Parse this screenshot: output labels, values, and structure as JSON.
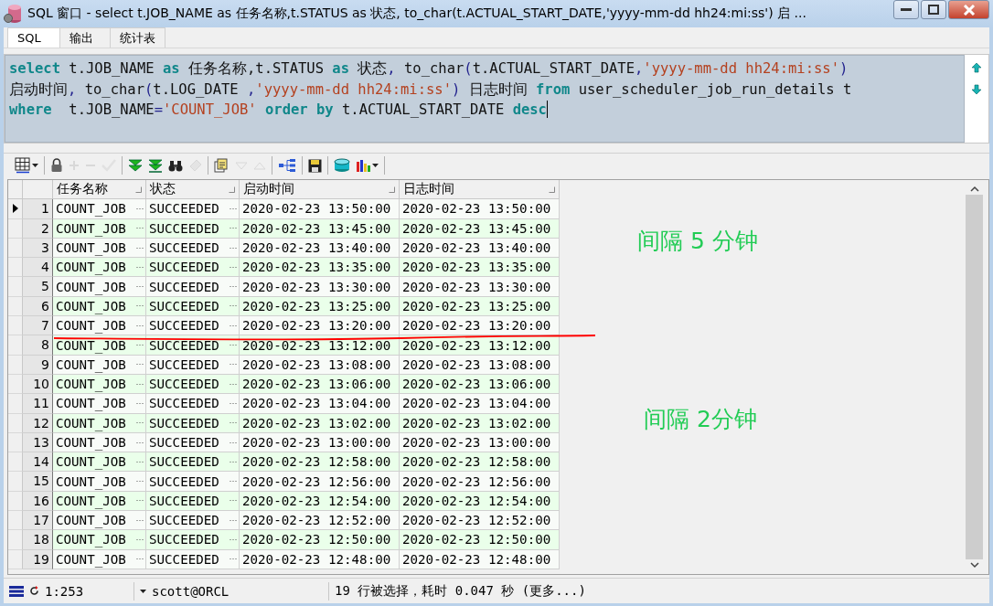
{
  "window": {
    "title": "SQL 窗口 - select t.JOB_NAME as 任务名称,t.STATUS as 状态, to_char(t.ACTUAL_START_DATE,'yyyy-mm-dd hh24:mi:ss') 启 ..."
  },
  "tabs": [
    {
      "label": "SQL",
      "selected": true
    },
    {
      "label": "输出",
      "selected": false
    },
    {
      "label": "统计表",
      "selected": false
    }
  ],
  "editor": {
    "lines": [
      [
        {
          "kind": "keyword",
          "text": "select"
        },
        {
          "kind": "plain",
          "text": " t.JOB_NAME "
        },
        {
          "kind": "keyword",
          "text": "as"
        },
        {
          "kind": "plain",
          "text": " 任务名称,t.STATUS "
        },
        {
          "kind": "keyword",
          "text": "as"
        },
        {
          "kind": "plain",
          "text": " 状态"
        },
        {
          "kind": "punct",
          "text": ","
        },
        {
          "kind": "plain",
          "text": " to_char"
        },
        {
          "kind": "punct",
          "text": "("
        },
        {
          "kind": "plain",
          "text": "t.ACTUAL_START_DATE"
        },
        {
          "kind": "punct",
          "text": ","
        },
        {
          "kind": "string",
          "text": "'yyyy-mm-dd hh24:mi:ss'"
        },
        {
          "kind": "punct",
          "text": ")"
        }
      ],
      [
        {
          "kind": "plain",
          "text": "启动时间"
        },
        {
          "kind": "punct",
          "text": ","
        },
        {
          "kind": "plain",
          "text": " to_char"
        },
        {
          "kind": "punct",
          "text": "("
        },
        {
          "kind": "plain",
          "text": "t.LOG_DATE "
        },
        {
          "kind": "punct",
          "text": ","
        },
        {
          "kind": "string",
          "text": "'yyyy-mm-dd hh24:mi:ss'"
        },
        {
          "kind": "punct",
          "text": ")"
        },
        {
          "kind": "plain",
          "text": " 日志时间 "
        },
        {
          "kind": "keyword",
          "text": "from"
        },
        {
          "kind": "plain",
          "text": " user_scheduler_job_run_details t"
        }
      ],
      [
        {
          "kind": "keyword",
          "text": "where"
        },
        {
          "kind": "plain",
          "text": "  t.JOB_NAME"
        },
        {
          "kind": "punct",
          "text": "="
        },
        {
          "kind": "string",
          "text": "'COUNT_JOB'"
        },
        {
          "kind": "keyword",
          "text": " order by"
        },
        {
          "kind": "plain",
          "text": " t.ACTUAL_START_DATE "
        },
        {
          "kind": "keyword",
          "text": "desc"
        }
      ]
    ]
  },
  "toolbar": [
    [
      {
        "kind": "grid-menu",
        "disabled": false
      }
    ],
    [
      {
        "kind": "lock",
        "disabled": false
      },
      {
        "kind": "add",
        "disabled": true
      },
      {
        "kind": "remove",
        "disabled": true
      },
      {
        "kind": "post",
        "disabled": true
      }
    ],
    [
      {
        "kind": "fetch-next",
        "disabled": false
      },
      {
        "kind": "fetch-all",
        "disabled": false
      },
      {
        "kind": "find",
        "disabled": false
      },
      {
        "kind": "clear",
        "disabled": true
      }
    ],
    [
      {
        "kind": "export",
        "disabled": false
      },
      {
        "kind": "next",
        "disabled": true
      },
      {
        "kind": "previous",
        "disabled": true
      }
    ],
    [
      {
        "kind": "tree",
        "disabled": false
      }
    ],
    [
      {
        "kind": "save",
        "disabled": false
      }
    ],
    [
      {
        "kind": "database",
        "disabled": false
      },
      {
        "kind": "chart",
        "disabled": false
      }
    ]
  ],
  "grid": {
    "columns": [
      "任务名称",
      "状态",
      "启动时间",
      "日志时间"
    ],
    "rows": [
      {
        "number": "1",
        "job_name": "COUNT_JOB",
        "status": "SUCCEEDED",
        "start_time": "2020-02-23 13:50:00",
        "log_time": "2020-02-23 13:50:00",
        "selected": true
      },
      {
        "number": "2",
        "job_name": "COUNT_JOB",
        "status": "SUCCEEDED",
        "start_time": "2020-02-23 13:45:00",
        "log_time": "2020-02-23 13:45:00",
        "selected": false
      },
      {
        "number": "3",
        "job_name": "COUNT_JOB",
        "status": "SUCCEEDED",
        "start_time": "2020-02-23 13:40:00",
        "log_time": "2020-02-23 13:40:00",
        "selected": false
      },
      {
        "number": "4",
        "job_name": "COUNT_JOB",
        "status": "SUCCEEDED",
        "start_time": "2020-02-23 13:35:00",
        "log_time": "2020-02-23 13:35:00",
        "selected": false
      },
      {
        "number": "5",
        "job_name": "COUNT_JOB",
        "status": "SUCCEEDED",
        "start_time": "2020-02-23 13:30:00",
        "log_time": "2020-02-23 13:30:00",
        "selected": false
      },
      {
        "number": "6",
        "job_name": "COUNT_JOB",
        "status": "SUCCEEDED",
        "start_time": "2020-02-23 13:25:00",
        "log_time": "2020-02-23 13:25:00",
        "selected": false
      },
      {
        "number": "7",
        "job_name": "COUNT_JOB",
        "status": "SUCCEEDED",
        "start_time": "2020-02-23 13:20:00",
        "log_time": "2020-02-23 13:20:00",
        "selected": false
      },
      {
        "number": "8",
        "job_name": "COUNT_JOB",
        "status": "SUCCEEDED",
        "start_time": "2020-02-23 13:12:00",
        "log_time": "2020-02-23 13:12:00",
        "selected": false
      },
      {
        "number": "9",
        "job_name": "COUNT_JOB",
        "status": "SUCCEEDED",
        "start_time": "2020-02-23 13:08:00",
        "log_time": "2020-02-23 13:08:00",
        "selected": false
      },
      {
        "number": "10",
        "job_name": "COUNT_JOB",
        "status": "SUCCEEDED",
        "start_time": "2020-02-23 13:06:00",
        "log_time": "2020-02-23 13:06:00",
        "selected": false
      },
      {
        "number": "11",
        "job_name": "COUNT_JOB",
        "status": "SUCCEEDED",
        "start_time": "2020-02-23 13:04:00",
        "log_time": "2020-02-23 13:04:00",
        "selected": false
      },
      {
        "number": "12",
        "job_name": "COUNT_JOB",
        "status": "SUCCEEDED",
        "start_time": "2020-02-23 13:02:00",
        "log_time": "2020-02-23 13:02:00",
        "selected": false
      },
      {
        "number": "13",
        "job_name": "COUNT_JOB",
        "status": "SUCCEEDED",
        "start_time": "2020-02-23 13:00:00",
        "log_time": "2020-02-23 13:00:00",
        "selected": false
      },
      {
        "number": "14",
        "job_name": "COUNT_JOB",
        "status": "SUCCEEDED",
        "start_time": "2020-02-23 12:58:00",
        "log_time": "2020-02-23 12:58:00",
        "selected": false
      },
      {
        "number": "15",
        "job_name": "COUNT_JOB",
        "status": "SUCCEEDED",
        "start_time": "2020-02-23 12:56:00",
        "log_time": "2020-02-23 12:56:00",
        "selected": false
      },
      {
        "number": "16",
        "job_name": "COUNT_JOB",
        "status": "SUCCEEDED",
        "start_time": "2020-02-23 12:54:00",
        "log_time": "2020-02-23 12:54:00",
        "selected": false
      },
      {
        "number": "17",
        "job_name": "COUNT_JOB",
        "status": "SUCCEEDED",
        "start_time": "2020-02-23 12:52:00",
        "log_time": "2020-02-23 12:52:00",
        "selected": false
      },
      {
        "number": "18",
        "job_name": "COUNT_JOB",
        "status": "SUCCEEDED",
        "start_time": "2020-02-23 12:50:00",
        "log_time": "2020-02-23 12:50:00",
        "selected": false
      },
      {
        "number": "19",
        "job_name": "COUNT_JOB",
        "status": "SUCCEEDED",
        "start_time": "2020-02-23 12:48:00",
        "log_time": "2020-02-23 12:48:00",
        "selected": false
      }
    ]
  },
  "annotations": [
    {
      "text": "间隔 5 分钟"
    },
    {
      "text": "间隔 2分钟"
    }
  ],
  "status_bar": {
    "position": "1:253",
    "connection": "scott@ORCL",
    "message": "19 行被选择，耗时 0.047 秒 (更多...)"
  }
}
